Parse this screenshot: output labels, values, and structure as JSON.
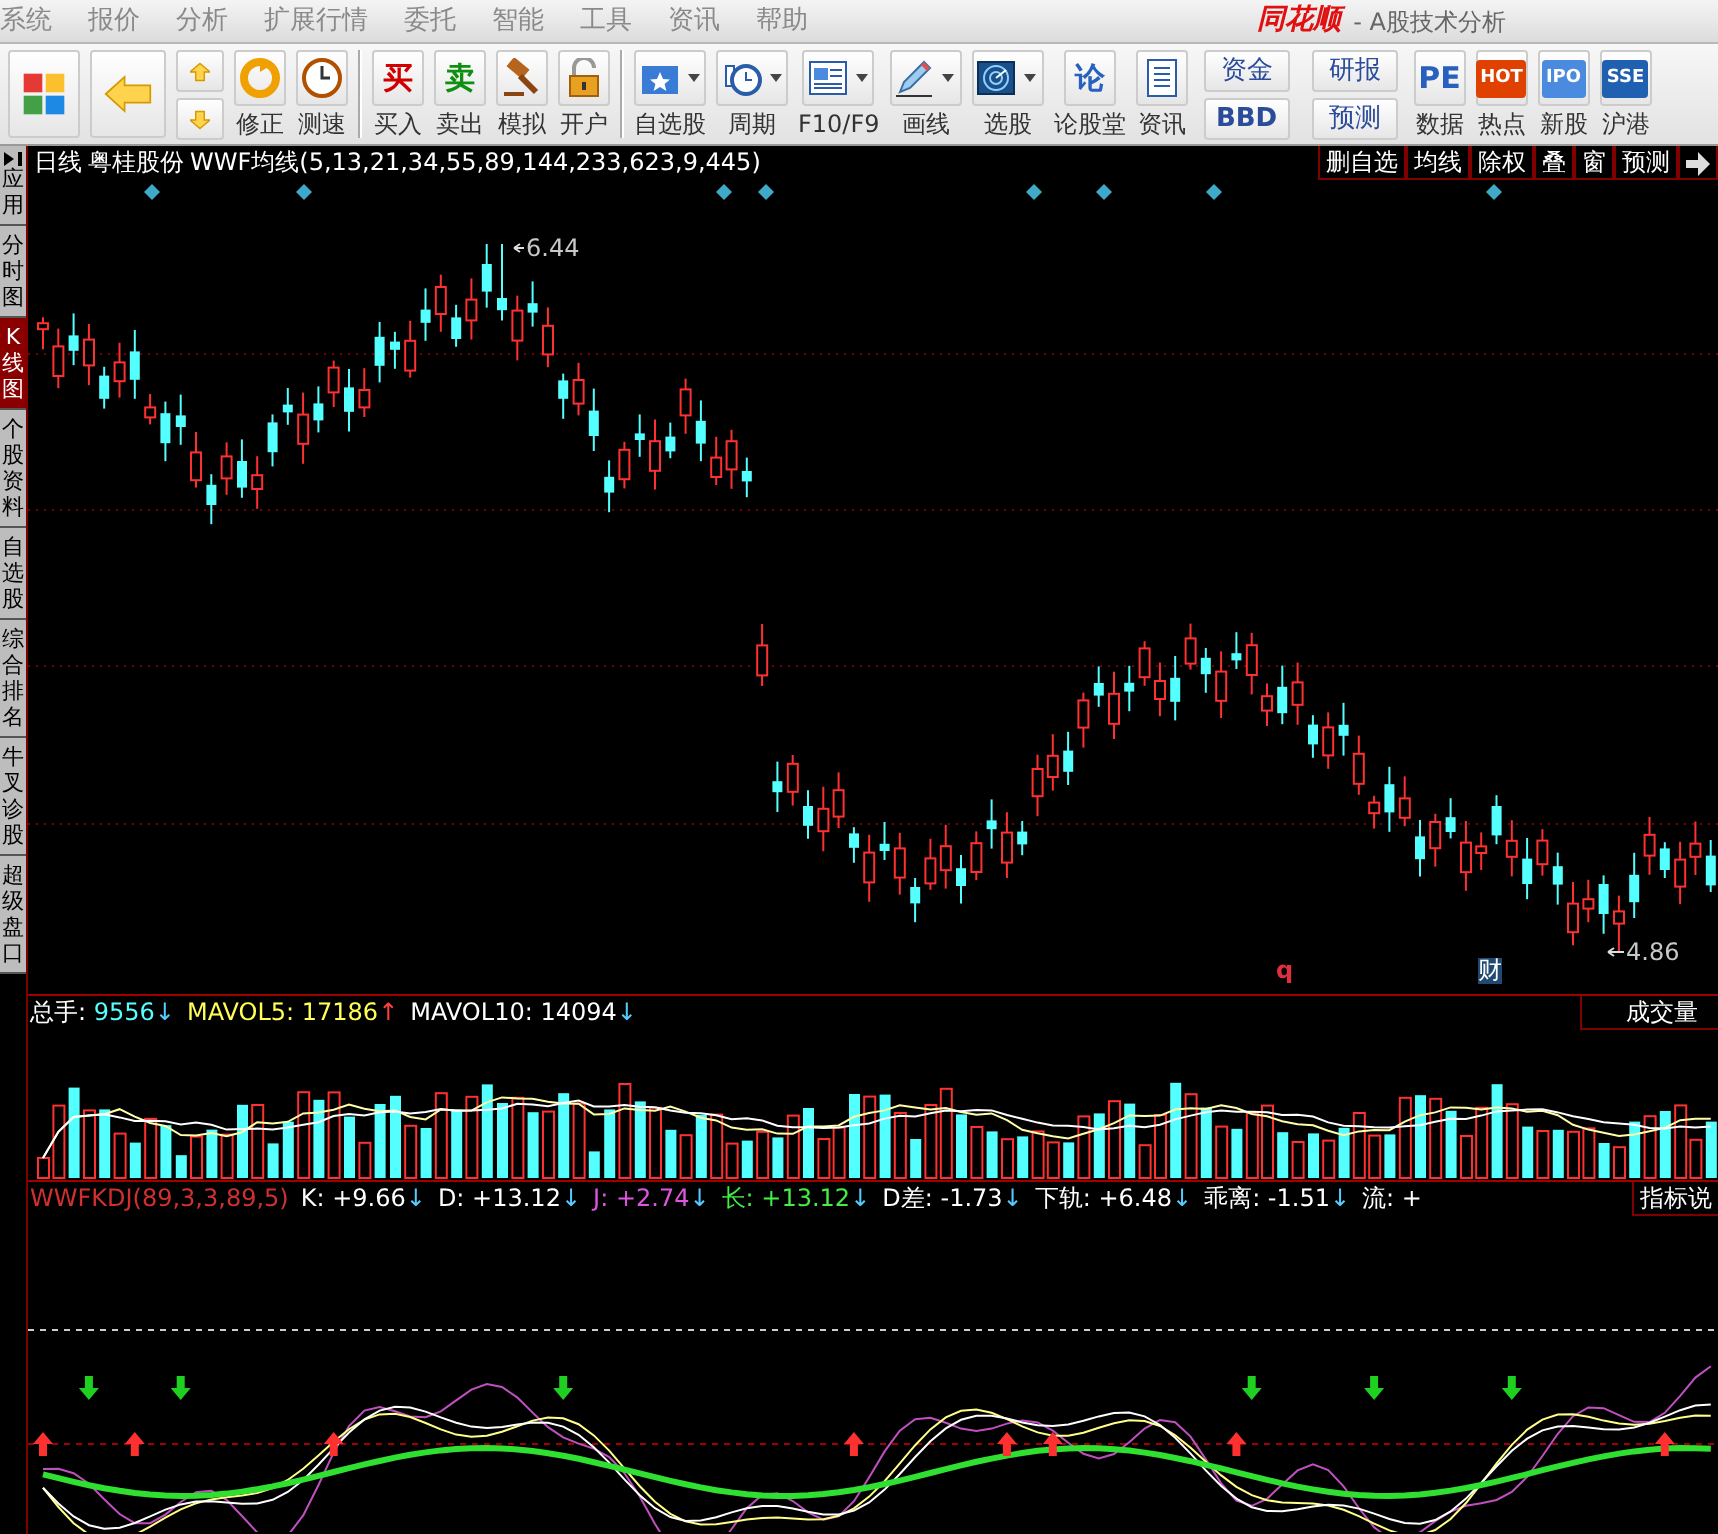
{
  "menu": [
    "系统",
    "报价",
    "分析",
    "扩展行情",
    "委托",
    "智能",
    "工具",
    "资讯",
    "帮助"
  ],
  "title": {
    "logo": "同花顺",
    "subtitle": "- A股技术分析"
  },
  "toolbar": [
    {
      "kind": "large"
    },
    {
      "kind": "large"
    },
    {
      "kind": "updown"
    },
    {
      "kind": "button",
      "label": "修正"
    },
    {
      "kind": "button",
      "label": "测速"
    },
    {
      "kind": "separator"
    },
    {
      "kind": "button",
      "label": "买入",
      "glyph": "买"
    },
    {
      "kind": "button",
      "label": "卖出",
      "glyph": "卖"
    },
    {
      "kind": "button",
      "label": "模拟"
    },
    {
      "kind": "button",
      "label": "开户"
    },
    {
      "kind": "separator"
    },
    {
      "kind": "split",
      "label": "自选股"
    },
    {
      "kind": "split",
      "label": "周期"
    },
    {
      "kind": "split",
      "label": "F10/F9"
    },
    {
      "kind": "split",
      "label": "画线"
    },
    {
      "kind": "split",
      "label": "选股"
    },
    {
      "kind": "button",
      "label": "论股堂",
      "glyph": "论"
    },
    {
      "kind": "button",
      "label": "资讯"
    },
    {
      "kind": "pair",
      "labels": [
        "资金",
        "BBD"
      ]
    },
    {
      "kind": "pair",
      "labels": [
        "研报",
        "预测"
      ]
    },
    {
      "kind": "button",
      "label": "数据",
      "glyph": "PE"
    },
    {
      "kind": "button",
      "label": "热点",
      "glyph": "HOT"
    },
    {
      "kind": "button",
      "label": "新股",
      "glyph": "IPO"
    },
    {
      "kind": "button",
      "label": "沪港",
      "glyph": "SSE"
    }
  ],
  "side_tabs": [
    {
      "label": "应用",
      "selected": false
    },
    {
      "label": "分时图",
      "selected": false
    },
    {
      "label": "K线图",
      "selected": true
    },
    {
      "label": "个股资料",
      "selected": false
    },
    {
      "label": "自选股",
      "selected": false
    },
    {
      "label": "综合排名",
      "selected": false
    },
    {
      "label": "牛叉诊股",
      "selected": false
    },
    {
      "label": "超级盘口",
      "selected": false
    }
  ],
  "chart": {
    "period": "日线",
    "stock": "粤桂股份",
    "indicator": "WWF均线(5,13,21,34,55,89,144,233,623,9,445)",
    "buttons": [
      "删自选",
      "均线",
      "除权",
      "叠",
      "窗",
      "预测"
    ],
    "high_label": "6.44",
    "low_label": "4.86",
    "event_marks": [
      {
        "text": "q",
        "kind": "plain"
      },
      {
        "text": "财",
        "kind": "boxed"
      }
    ]
  },
  "volume": {
    "readouts": [
      {
        "label": "总手:",
        "value": "9556",
        "arrow": "↓",
        "rising": false,
        "color": "#55ffff"
      },
      {
        "label": "MAVOL5:",
        "value": "17186",
        "arrow": "↑",
        "rising": true,
        "color": "#ffff55"
      },
      {
        "label": "MAVOL10:",
        "value": "14094",
        "arrow": "↓",
        "rising": false,
        "color": "#ffffff"
      }
    ],
    "button": "成交量"
  },
  "kdj": {
    "name": "WWFKDJ(89,3,3,89,5)",
    "readouts": [
      {
        "label": "K:",
        "value": "+9.66",
        "arrow": "↓",
        "rising": false,
        "color": "#ffffff"
      },
      {
        "label": "D:",
        "value": "+13.12",
        "arrow": "↓",
        "rising": false,
        "color": "#ffffff"
      },
      {
        "label": "J:",
        "value": "+2.74",
        "arrow": "↓",
        "rising": false,
        "color": "#e055e0"
      },
      {
        "label": "长:",
        "value": "+13.12",
        "arrow": "↓",
        "rising": false,
        "color": "#44ee44"
      },
      {
        "label": "D差:",
        "value": "-1.73",
        "arrow": "↓",
        "rising": false,
        "color": "#ffffff"
      },
      {
        "label": "下轨:",
        "value": "+6.48",
        "arrow": "↓",
        "rising": false,
        "color": "#ffffff"
      },
      {
        "label": "乖离:",
        "value": "-1.51",
        "arrow": "↓",
        "rising": false,
        "color": "#ffffff"
      },
      {
        "label": "流:",
        "value": "+",
        "color": "#ffffff"
      }
    ],
    "button": "指标说"
  }
}
